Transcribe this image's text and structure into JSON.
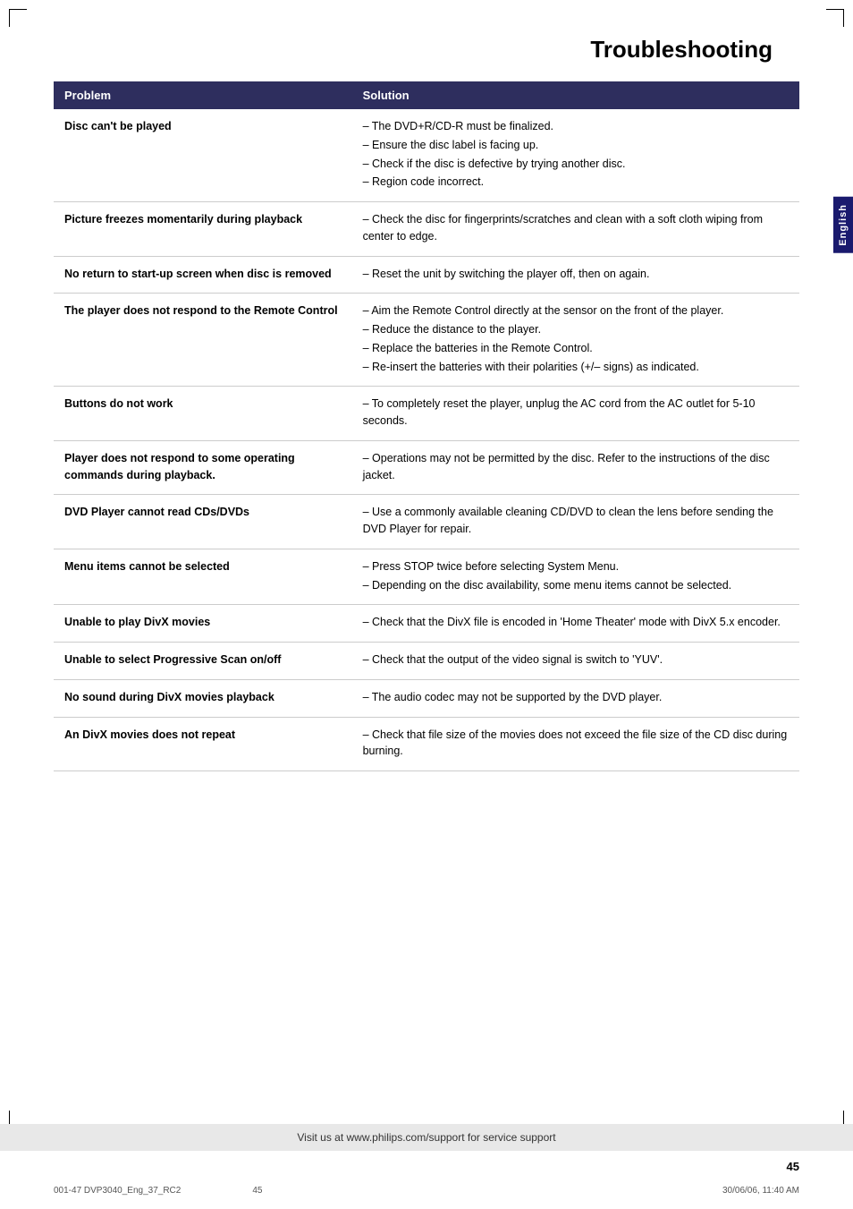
{
  "page": {
    "title": "Troubleshooting",
    "english_tab": "English",
    "page_number": "45",
    "footer_text": "Visit us at www.philips.com/support for service support",
    "print_info_left": "001-47 DVP3040_Eng_37_RC2",
    "print_info_middle": "45",
    "print_info_right": "30/06/06, 11:40 AM"
  },
  "table": {
    "headers": {
      "problem": "Problem",
      "solution": "Solution"
    },
    "rows": [
      {
        "problem": "Disc can't be played",
        "solutions": [
          "The DVD+R/CD-R must be finalized.",
          "Ensure the disc label is facing up.",
          "Check if the disc is defective by trying another disc.",
          "Region code incorrect."
        ]
      },
      {
        "problem": "Picture freezes momentarily during playback",
        "solutions": [
          "Check the disc for fingerprints/scratches and clean with a soft cloth wiping from center to edge."
        ]
      },
      {
        "problem": "No return to start-up screen when disc is removed",
        "solutions": [
          "Reset the unit by switching the player off, then on again."
        ]
      },
      {
        "problem": "The player does not respond to the Remote Control",
        "solutions": [
          "Aim the Remote Control directly at the sensor on the front of the player.",
          "Reduce the distance to the player.",
          "Replace the batteries in the Remote Control.",
          "Re-insert the batteries with their polarities (+/– signs) as indicated."
        ]
      },
      {
        "problem": "Buttons do not work",
        "solutions": [
          "To completely reset the player, unplug the AC cord from the AC outlet for 5-10 seconds."
        ]
      },
      {
        "problem": "Player does not respond to some operating commands during playback.",
        "solutions": [
          "Operations may not be permitted by the disc. Refer to the instructions of  the disc jacket."
        ]
      },
      {
        "problem": "DVD Player cannot read CDs/DVDs",
        "solutions": [
          "Use a commonly available cleaning CD/DVD to clean the lens before sending the DVD Player for repair."
        ]
      },
      {
        "problem": "Menu items cannot be selected",
        "solutions": [
          "Press STOP twice before selecting System Menu.",
          "Depending on the disc availability, some menu items cannot be selected."
        ]
      },
      {
        "problem": "Unable to play DivX movies",
        "solutions": [
          "Check that the DivX file is encoded in 'Home Theater' mode with DivX 5.x encoder."
        ]
      },
      {
        "problem": "Unable to select Progressive Scan on/off",
        "solutions": [
          "Check that the output of the video signal is switch to 'YUV'."
        ]
      },
      {
        "problem": "No sound during DivX movies playback",
        "solutions": [
          "The audio codec may not be supported by the DVD player."
        ]
      },
      {
        "problem": "An DivX movies does not repeat",
        "solutions": [
          "Check that file size of the movies does not exceed the file size of the CD disc during burning."
        ]
      }
    ]
  }
}
